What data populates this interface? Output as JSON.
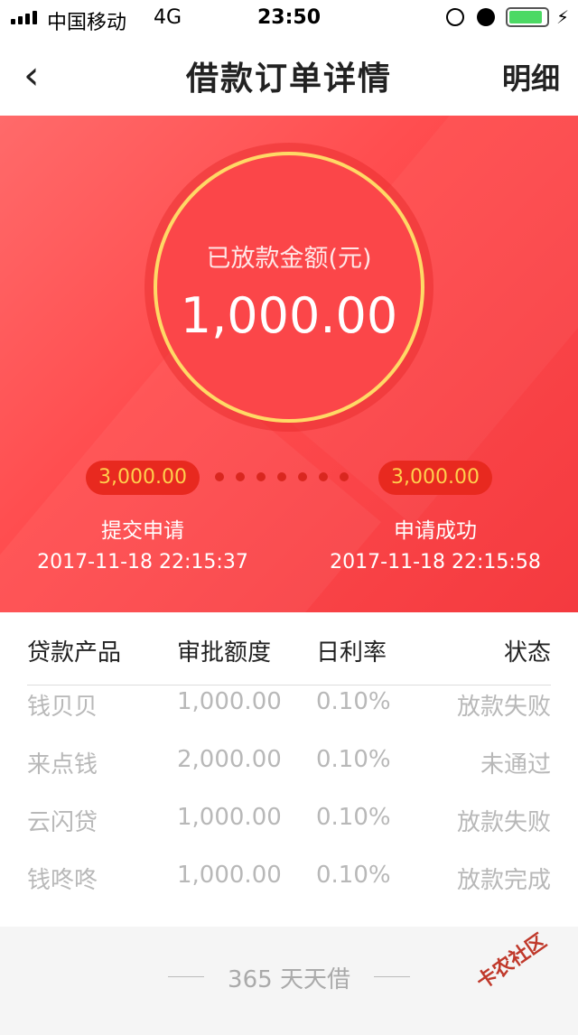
{
  "status": {
    "carrier": "中国移动",
    "network": "4G",
    "time": "23:50"
  },
  "nav": {
    "back_icon": "‹",
    "title": "借款订单详情",
    "detail": "明细"
  },
  "loan": {
    "label": "已放款金额(元)",
    "amount": "1,000.00"
  },
  "steps": [
    {
      "amount": "3,000.00",
      "label": "提交申请",
      "time": "2017-11-18 22:15:37"
    },
    {
      "amount": "3,000.00",
      "label": "申请成功",
      "time": "2017-11-18 22:15:58"
    }
  ],
  "table": {
    "headers": [
      "贷款产品",
      "审批额度",
      "日利率",
      "状态"
    ],
    "rows": [
      [
        "钱贝贝",
        "1,000.00",
        "0.10%",
        "放款失败"
      ],
      [
        "来点钱",
        "2,000.00",
        "0.10%",
        "未通过"
      ],
      [
        "云闪贷",
        "1,000.00",
        "0.10%",
        "放款失败"
      ],
      [
        "钱咚咚",
        "1,000.00",
        "0.10%",
        "放款完成"
      ]
    ]
  },
  "footer": {
    "text": "365 天天借"
  },
  "watermark": {
    "text": "卡农社区"
  }
}
